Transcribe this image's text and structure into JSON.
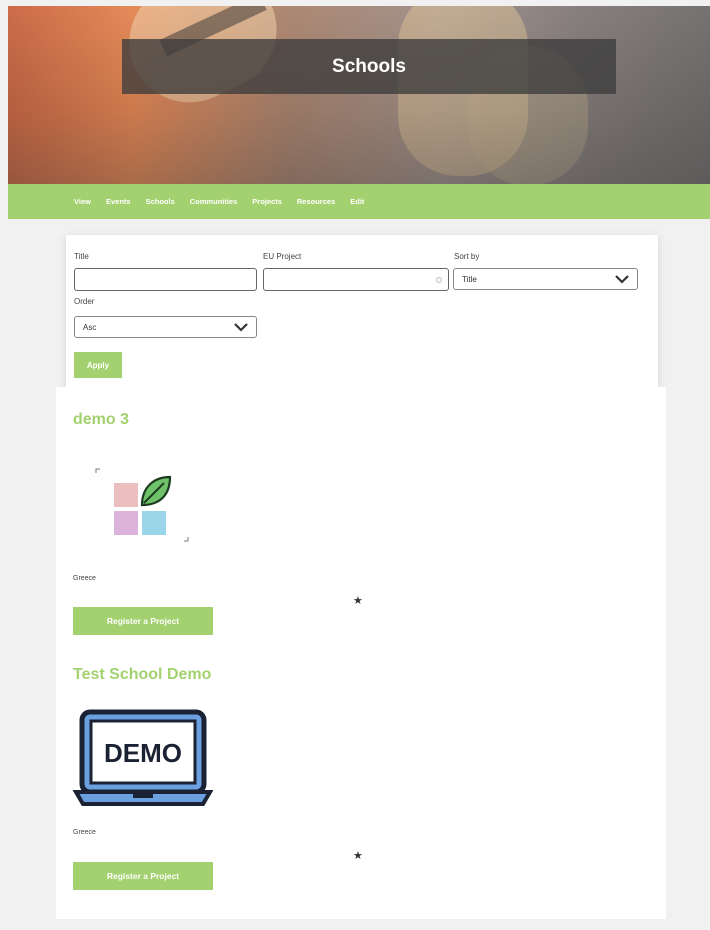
{
  "hero": {
    "title": "Schools"
  },
  "nav": {
    "items": [
      "View",
      "Events",
      "Schools",
      "Communities",
      "Projects",
      "Resources",
      "Edit"
    ]
  },
  "filters": {
    "title_label": "Title",
    "title_value": "",
    "eu_project_label": "EU Project",
    "eu_project_value": "",
    "sort_by_label": "Sort by",
    "sort_by_value": "Title",
    "order_label": "Order",
    "order_value": "Asc",
    "apply_label": "Apply"
  },
  "schools": [
    {
      "name": "demo 3",
      "country": "Greece",
      "star": "★",
      "button": "Register a Project",
      "logo": "leaf-squares-logo"
    },
    {
      "name": "Test School Demo",
      "country": "Greece",
      "star": "★",
      "button": "Register a Project",
      "logo": "laptop-demo-logo",
      "logo_text": "DEMO"
    }
  ],
  "colors": {
    "accent": "#a3d16f",
    "hero_overlay": "#3c3c3c"
  }
}
